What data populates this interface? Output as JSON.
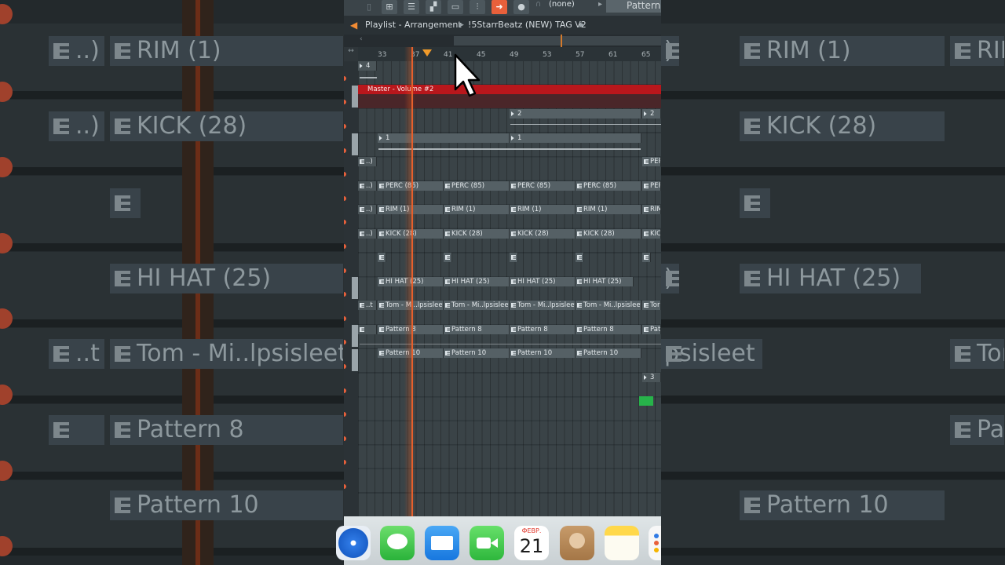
{
  "toolbar": {
    "pattern_selector_value": "(none)",
    "pattern_label": "Pattern"
  },
  "window": {
    "title": "Playlist - Arrangement",
    "project": "!5StarrBeatz (NEW) TAG V2"
  },
  "ruler": {
    "bars": [
      "33",
      "37",
      "41",
      "45",
      "49",
      "53",
      "57",
      "61",
      "65"
    ]
  },
  "automation": {
    "label": "Master - Volume #2",
    "color": "#b8171c"
  },
  "clips": {
    "top_small": "4",
    "pattern_2": "2",
    "pattern_1": "1",
    "pattern_3": "3",
    "perc_short": "PERC",
    "perc": "PERC (85)",
    "rim": "RIM (1)",
    "rim_short": "RIM",
    "kick": "KICK (28)",
    "kick_short": "KIC",
    "hihat": "HI HAT (25)",
    "tom": "Tom - Mi..lpsisleet",
    "tom_short": "Tor",
    "pattern8": "Pattern 8",
    "pattern8_short": "Pat",
    "pattern10": "Pattern 10",
    "truncated_prefix": "..)",
    "truncated_prefix_t": "..t"
  },
  "dock": {
    "calendar_month": "ФЕВР.",
    "calendar_day": "21"
  },
  "background": {
    "rim": "RIM (1)",
    "kick": "KICK (28)",
    "hihat": "HI HAT (25)",
    "tom": "Tom - Mi..lpsisleet",
    "tom_short": "Tom",
    "pattern8": "Pattern 8",
    "pattern8_short": "Pat",
    "pattern10": "Pattern 10",
    "ellipsis_paren": "..)",
    "ellipsis_t": "..t",
    "rim_short": "RIM",
    "kick_short": "KICK",
    "hihat_tail": "HI HAT (25)",
    "paren_tail": ")",
    "tom_tail": "psisleet"
  },
  "colors": {
    "accent": "#e8603b",
    "playhead": "#e6602c",
    "green_clip": "#27b34a"
  }
}
